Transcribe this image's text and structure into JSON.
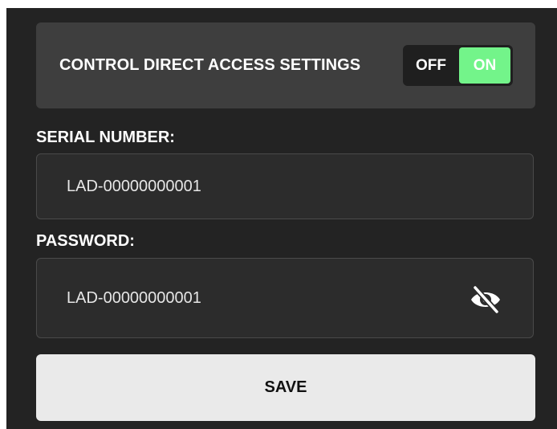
{
  "direct_access": {
    "label": "CONTROL DIRECT ACCESS SETTINGS",
    "toggle": {
      "off_label": "OFF",
      "on_label": "ON",
      "selected": "ON",
      "active_color": "#73f48a"
    }
  },
  "serial_number": {
    "label": "SERIAL NUMBER:",
    "value": "LAD-00000000001"
  },
  "password": {
    "label": "PASSWORD:",
    "value": "LAD-00000000001",
    "visibility_icon": "eye-slash-icon"
  },
  "save_button": {
    "label": "SAVE"
  }
}
